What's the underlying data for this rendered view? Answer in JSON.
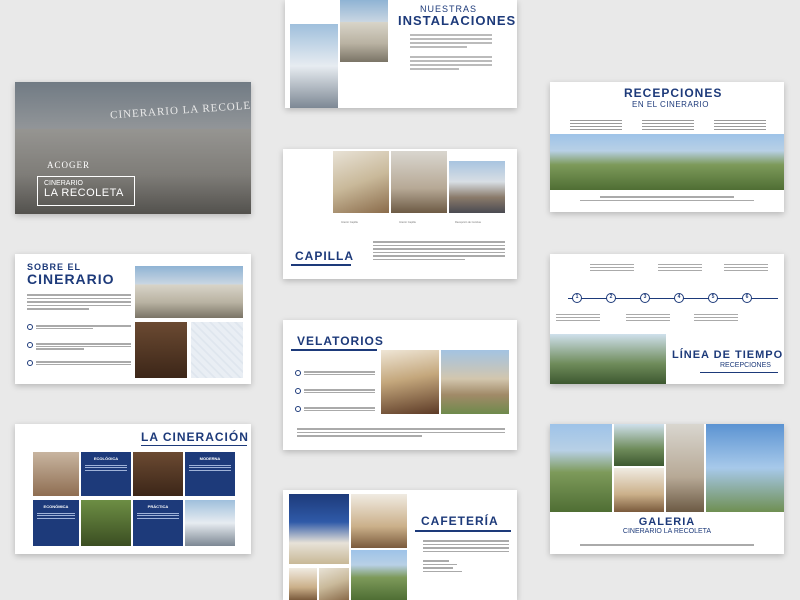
{
  "colors": {
    "brand": "#1d3a7a",
    "background": "#e9e9e9"
  },
  "cover": {
    "overline": "ACOGER",
    "title_line1": "CINERARIO",
    "title_line2": "LA RECOLETA",
    "sign": "CINERARIO LA RECOLETA"
  },
  "instalaciones": {
    "title_line1": "NUESTRAS",
    "title_line2": "INSTALACIONES"
  },
  "recepciones": {
    "title_line1": "RECEPCIONES",
    "title_line2": "EN EL CINERARIO"
  },
  "capilla": {
    "title": "CAPILLA",
    "captions": [
      "Interior Capilla",
      "Interior Capilla",
      "Recepción de Cenizas"
    ]
  },
  "sobre": {
    "title_line1": "SOBRE EL",
    "title_line2": "CINERARIO"
  },
  "timeline": {
    "title": "LÍNEA DE TIEMPO",
    "subtitle": "RECEPCIONES",
    "steps": [
      "1",
      "2",
      "3",
      "4",
      "5",
      "6"
    ]
  },
  "velatorios": {
    "title": "VELATORIOS"
  },
  "cineracion": {
    "title": "LA CINERACIÓN",
    "boxes": [
      {
        "heading": "ECOLÓGICA"
      },
      {
        "heading": "MODERNA"
      },
      {
        "heading": "ECONÓMICA"
      },
      {
        "heading": "PRÁCTICA"
      }
    ]
  },
  "cafeteria": {
    "title": "CAFETERÍA"
  },
  "galeria": {
    "title": "GALERIA",
    "subtitle": "CINERARIO LA RECOLETA"
  }
}
